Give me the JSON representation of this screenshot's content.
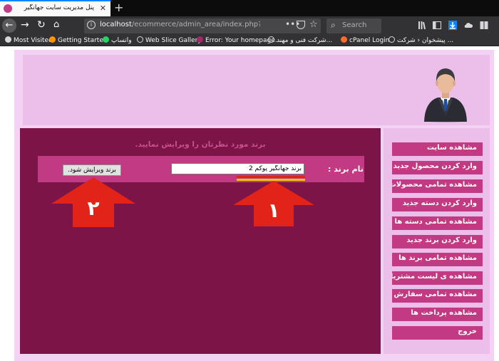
{
  "browser": {
    "tab_title": "پنل مدیریت سایت جهانگیر پوکم",
    "url_host": "localhost",
    "url_path": "/ecommerce/admin_area/index.php?edit_brand",
    "search_placeholder": "Search",
    "bookmarks": [
      {
        "label": "Most Visited",
        "icon": "gear-icon",
        "color": "#d7d7db"
      },
      {
        "label": "Getting Started",
        "icon": "firefox-icon",
        "color": "#ff9400"
      },
      {
        "label": "واتساپ",
        "icon": "whatsapp-icon",
        "color": "#25d366"
      },
      {
        "label": "Web Slice Gallery",
        "icon": "globe-icon",
        "color": "#d7d7db"
      },
      {
        "label": "Error: Your homepage...",
        "icon": "yoast-icon",
        "color": "#a4286a"
      },
      {
        "label": "شرکت فنی و مهند...",
        "icon": "globe-icon",
        "color": "#d7d7db"
      },
      {
        "label": "cPanel Login",
        "icon": "cpanel-icon",
        "color": "#ff6c2c"
      },
      {
        "label": "پیشخوان ‹ شرکت ...",
        "icon": "globe-icon",
        "color": "#d7d7db"
      }
    ]
  },
  "main": {
    "instruction": "برند مورد نظرتان را ویرایش نمایید.",
    "field_label": "نام برند :",
    "brand_value": "برند جهانگیر پوکم 2",
    "submit_label": "برند ویرایش شود."
  },
  "annotations": {
    "arrow_1": "۱",
    "arrow_2": "۲",
    "arrow_color": "#e2231a",
    "underline_colors": [
      "#e2231a",
      "#f4c10e"
    ]
  },
  "sidebar": {
    "items": [
      {
        "label": "مشاهده سایت"
      },
      {
        "label": "وارد کردن محصول جدید"
      },
      {
        "label": "مشاهده تمامی محصولات"
      },
      {
        "label": "وارد کردن دسته جدید"
      },
      {
        "label": "مشاهده تمامی دسته ها"
      },
      {
        "label": "وارد کردن برند جدید"
      },
      {
        "label": "مشاهده تمامی برند ها"
      },
      {
        "label": "مشاهده ی لیست مشتریان"
      },
      {
        "label": "مشاهده تمامی سفارش ها"
      },
      {
        "label": "مشاهده پرداخت ها"
      },
      {
        "label": "خروج"
      }
    ]
  },
  "colors": {
    "header_bg": "#ebbfe9",
    "content_bg": "#7d1447",
    "form_row_bg": "#c23b82",
    "menu_item_bg": "#c23b82",
    "frame_bg": "#f3d2f3"
  }
}
